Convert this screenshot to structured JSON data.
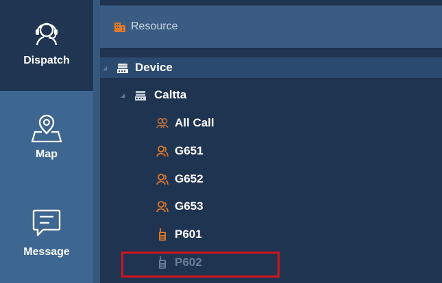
{
  "nav": {
    "items": [
      {
        "label": "Dispatch",
        "icon": "headset-operator-icon",
        "active": true
      },
      {
        "label": "Map",
        "icon": "map-pin-icon",
        "active": false
      },
      {
        "label": "Message",
        "icon": "message-icon",
        "active": false
      }
    ]
  },
  "resource": {
    "title": "Resource",
    "icon": "building-icon"
  },
  "tree": {
    "device": {
      "label": "Device",
      "icon": "device-icon"
    },
    "org": {
      "label": "Caltta",
      "icon": "device-icon"
    },
    "items": [
      {
        "label": "All Call",
        "icon": "group-call-icon"
      },
      {
        "label": "G651",
        "icon": "group-icon"
      },
      {
        "label": "G652",
        "icon": "group-icon"
      },
      {
        "label": "G653",
        "icon": "group-icon"
      },
      {
        "label": "P601",
        "icon": "radio-icon"
      },
      {
        "label": "P602",
        "icon": "radio-icon",
        "status": "offline"
      }
    ]
  },
  "colors": {
    "nav_bg": "#3d6690",
    "tree_bg": "#1f3450",
    "icon_orange": "#e07a28",
    "highlight_box": "#d4141c"
  }
}
